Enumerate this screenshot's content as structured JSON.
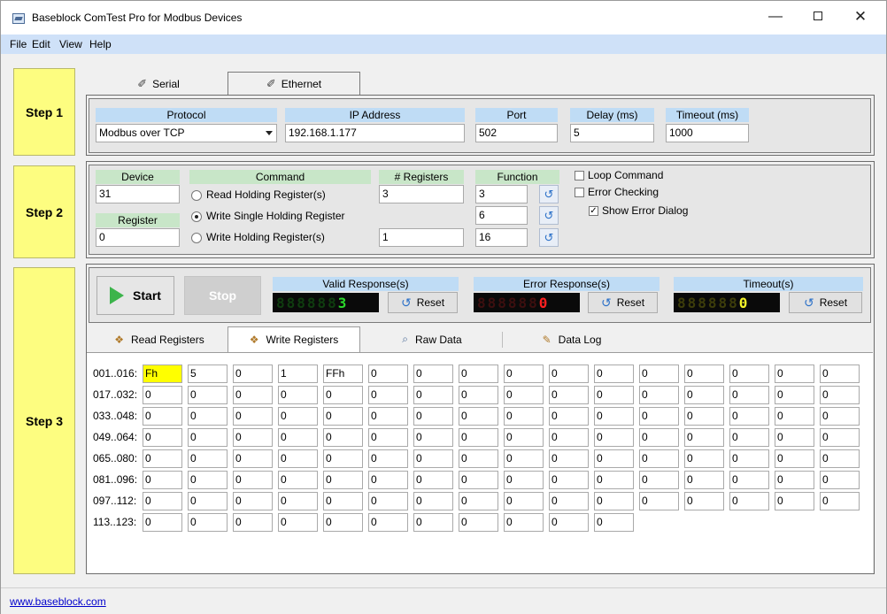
{
  "window": {
    "title": "Baseblock ComTest Pro for Modbus Devices",
    "minimize": "—",
    "close": "✕"
  },
  "menu": [
    {
      "label": "File"
    },
    {
      "label": "Edit"
    },
    {
      "label": "View"
    },
    {
      "label": "Help"
    }
  ],
  "steps": {
    "step1": "Step 1",
    "step2": "Step 2",
    "step3": "Step 3"
  },
  "connection_tabs": [
    {
      "label": "Serial",
      "icon": "wrench-icon",
      "active": false
    },
    {
      "label": "Ethernet",
      "icon": "wrench-icon",
      "active": true
    }
  ],
  "step1": {
    "protocol": {
      "header": "Protocol",
      "value": "Modbus over TCP"
    },
    "ip": {
      "header": "IP Address",
      "value": "192.168.1.177"
    },
    "port": {
      "header": "Port",
      "value": "502"
    },
    "delay": {
      "header": "Delay (ms)",
      "value": "5"
    },
    "timeout": {
      "header": "Timeout (ms)",
      "value": "1000"
    }
  },
  "step2": {
    "device": {
      "header": "Device",
      "value": "31"
    },
    "register": {
      "header": "Register",
      "value": "0"
    },
    "command_header": "Command",
    "registers_header": "# Registers",
    "function_header": "Function",
    "commands": [
      {
        "label": "Read Holding Register(s)",
        "selected": false,
        "registers": "3",
        "function": "3"
      },
      {
        "label": "Write Single Holding Register",
        "selected": true,
        "registers": "",
        "function": "6"
      },
      {
        "label": "Write Holding Register(s)",
        "selected": false,
        "registers": "1",
        "function": "16"
      }
    ],
    "options": {
      "loop": {
        "label": "Loop Command",
        "checked": false
      },
      "error_check": {
        "label": "Error Checking",
        "checked": false
      },
      "show_error": {
        "label": "Show Error Dialog",
        "checked": true
      }
    }
  },
  "step3": {
    "start_label": "Start",
    "stop_label": "Stop",
    "reset_label": "Reset",
    "counters": [
      {
        "header": "Valid Response(s)",
        "dim": "888888",
        "value": "3",
        "color": "#2bd82b",
        "dim_color": "#0f3d0f",
        "header_bg": "#bfdcf5"
      },
      {
        "header": "Error Response(s)",
        "dim": "888888",
        "value": "0",
        "color": "#ff2020",
        "dim_color": "#3d0f0f",
        "header_bg": "#bfdcf5"
      },
      {
        "header": "Timeout(s)",
        "dim": "888888",
        "value": "0",
        "color": "#f5f52a",
        "dim_color": "#3d3d0a",
        "header_bg": "#bfdcf5"
      }
    ],
    "tabs": [
      {
        "label": "Read Registers",
        "icon": "layers-icon",
        "active": false
      },
      {
        "label": "Write Registers",
        "icon": "layers-icon",
        "active": true
      },
      {
        "label": "Raw Data",
        "icon": "magnifier-icon",
        "active": false
      },
      {
        "label": "Data Log",
        "icon": "notepad-icon",
        "active": false
      }
    ],
    "rows": [
      {
        "label": "001..016:",
        "cells": [
          "Fh",
          "5",
          "0",
          "1",
          "FFh",
          "0",
          "0",
          "0",
          "0",
          "0",
          "0",
          "0",
          "0",
          "0",
          "0",
          "0"
        ]
      },
      {
        "label": "017..032:",
        "cells": [
          "0",
          "0",
          "0",
          "0",
          "0",
          "0",
          "0",
          "0",
          "0",
          "0",
          "0",
          "0",
          "0",
          "0",
          "0",
          "0"
        ]
      },
      {
        "label": "033..048:",
        "cells": [
          "0",
          "0",
          "0",
          "0",
          "0",
          "0",
          "0",
          "0",
          "0",
          "0",
          "0",
          "0",
          "0",
          "0",
          "0",
          "0"
        ]
      },
      {
        "label": "049..064:",
        "cells": [
          "0",
          "0",
          "0",
          "0",
          "0",
          "0",
          "0",
          "0",
          "0",
          "0",
          "0",
          "0",
          "0",
          "0",
          "0",
          "0"
        ]
      },
      {
        "label": "065..080:",
        "cells": [
          "0",
          "0",
          "0",
          "0",
          "0",
          "0",
          "0",
          "0",
          "0",
          "0",
          "0",
          "0",
          "0",
          "0",
          "0",
          "0"
        ]
      },
      {
        "label": "081..096:",
        "cells": [
          "0",
          "0",
          "0",
          "0",
          "0",
          "0",
          "0",
          "0",
          "0",
          "0",
          "0",
          "0",
          "0",
          "0",
          "0",
          "0"
        ]
      },
      {
        "label": "097..112:",
        "cells": [
          "0",
          "0",
          "0",
          "0",
          "0",
          "0",
          "0",
          "0",
          "0",
          "0",
          "0",
          "0",
          "0",
          "0",
          "0",
          "0"
        ]
      },
      {
        "label": "113..123:",
        "cells": [
          "0",
          "0",
          "0",
          "0",
          "0",
          "0",
          "0",
          "0",
          "0",
          "0",
          "0"
        ]
      }
    ]
  },
  "status": {
    "link": "www.baseblock.com"
  },
  "colors": {
    "menu_bg": "#cfe1f8",
    "step_bg": "#fdfd80",
    "header_blue": "#bfdcf5",
    "header_green": "#c8e6c8",
    "highlight_cell": "#ffff00"
  }
}
